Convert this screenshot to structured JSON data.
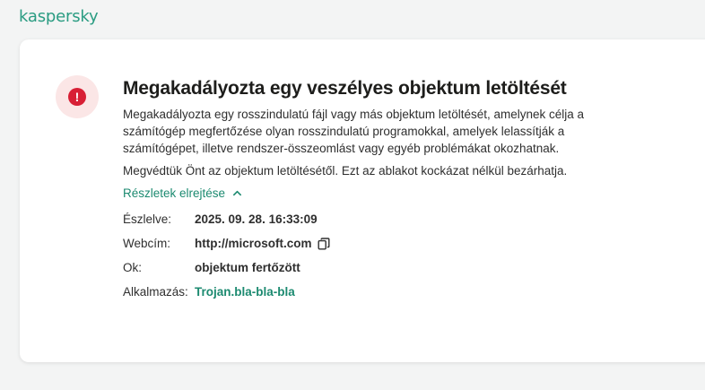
{
  "brand": {
    "logo_text": "kaspersky",
    "accent": "#2a9c82"
  },
  "alert": {
    "icon": "exclamation-icon",
    "glyph": "!",
    "title": "Megakadályozta egy veszélyes objektum letöltését",
    "description": "Megakadályozta egy rosszindulatú fájl vagy más objektum letöltését, amelynek célja a számítógép megfertőzése olyan rosszindulatú programokkal, amelyek lelassítják a számítógépet, illetve rendszer-összeomlást vagy egyéb problémákat okozhatnak.",
    "protected_text": "Megvédtük Önt az objektum letöltésétől. Ezt az ablakot kockázat nélkül bezárhatja.",
    "toggle_label": "Részletek elrejtése",
    "color": "#d81f35"
  },
  "details": {
    "detected_label": "Észlelve:",
    "detected_value": "2025. 09. 28. 16:33:09",
    "url_label": "Webcím:",
    "url_value": "http://microsoft.com",
    "reason_label": "Ok:",
    "reason_value": "objektum fertőzött",
    "app_label": "Alkalmazás:",
    "app_value": "Trojan.bla-bla-bla"
  }
}
